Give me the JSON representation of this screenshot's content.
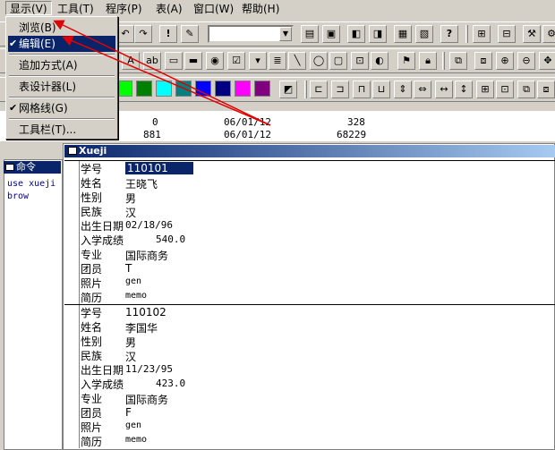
{
  "menubar": [
    "显示(V)",
    "工具(T)",
    "程序(P)",
    "表(A)",
    "窗口(W)",
    "帮助(H)"
  ],
  "dropdown": {
    "items": [
      {
        "label": "浏览(B)",
        "checked": false,
        "highlighted": false
      },
      {
        "label": "编辑(E)",
        "checked": true,
        "highlighted": true
      },
      {
        "label": "追加方式(A)",
        "checked": false,
        "highlighted": false
      },
      {
        "label": "表设计器(L)",
        "checked": false,
        "highlighted": false
      },
      {
        "label": "网格线(G)",
        "checked": true,
        "highlighted": false
      },
      {
        "label": "工具栏(T)...",
        "checked": false,
        "highlighted": false
      }
    ]
  },
  "colors": {
    "swatches": [
      "#00ff00",
      "#008000",
      "#00ffff",
      "#008080",
      "#0000ff",
      "#000080",
      "#ff00ff",
      "#800080"
    ],
    "annotation_arrow": "#e00000",
    "title_bar": "#0a246a"
  },
  "background_rows": [
    {
      "a": "0",
      "b": "06/01/12",
      "c": "328"
    },
    {
      "a": "881",
      "b": "06/01/12",
      "c": "68229"
    }
  ],
  "command_window": {
    "title": "命令",
    "lines": [
      "use xueji",
      "brow"
    ]
  },
  "browse_window": {
    "title": "Xueji",
    "records": [
      {
        "fields": [
          {
            "label": "学号",
            "value": "110101"
          },
          {
            "label": "姓名",
            "value": "王晓飞"
          },
          {
            "label": "性别",
            "value": "男"
          },
          {
            "label": "民族",
            "value": "汉"
          },
          {
            "label": "出生日期",
            "value": "02/18/96"
          },
          {
            "label": "入学成绩",
            "value": "540.0"
          },
          {
            "label": "专业",
            "value": "国际商务"
          },
          {
            "label": "团员",
            "value": "T"
          },
          {
            "label": "照片",
            "value": "gen"
          },
          {
            "label": "简历",
            "value": "memo"
          }
        ]
      },
      {
        "fields": [
          {
            "label": "学号",
            "value": "110102"
          },
          {
            "label": "姓名",
            "value": "李国华"
          },
          {
            "label": "性别",
            "value": "男"
          },
          {
            "label": "民族",
            "value": "汉"
          },
          {
            "label": "出生日期",
            "value": "11/23/95"
          },
          {
            "label": "入学成绩",
            "value": "423.0"
          },
          {
            "label": "专业",
            "value": "国际商务"
          },
          {
            "label": "团员",
            "value": "F"
          },
          {
            "label": "照片",
            "value": "gen"
          },
          {
            "label": "简历",
            "value": "memo"
          }
        ]
      }
    ]
  }
}
